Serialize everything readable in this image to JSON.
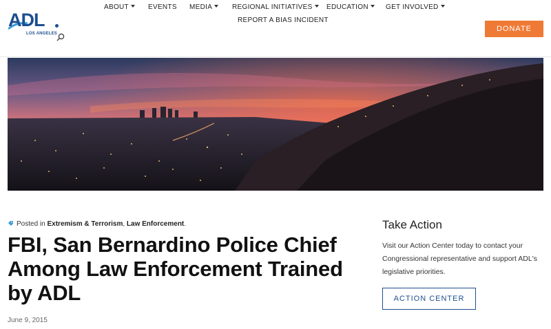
{
  "logo": {
    "text": "ADL",
    "subtext": "LOS ANGELES"
  },
  "nav": {
    "items": [
      {
        "label": "ABOUT",
        "dropdown": true
      },
      {
        "label": "EVENTS",
        "dropdown": false
      },
      {
        "label": "MEDIA",
        "dropdown": true
      },
      {
        "label": "REGIONAL INITIATIVES",
        "dropdown": true
      },
      {
        "label": "EDUCATION",
        "dropdown": true
      },
      {
        "label": "GET INVOLVED",
        "dropdown": true
      },
      {
        "label": "REPORT A BIAS INCIDENT",
        "dropdown": false
      }
    ]
  },
  "donate": {
    "label": "DONATE"
  },
  "icons": {
    "search": "search-icon",
    "tag": "tag-icon"
  },
  "colors": {
    "brand_blue": "#1d4e8f",
    "donate_orange": "#ef7a35"
  },
  "article": {
    "posted_prefix": "Posted in",
    "categories": [
      "Extremism & Terrorism",
      "Law Enforcement"
    ],
    "category_separator": ",",
    "posted_suffix": ".",
    "title": "FBI, San Bernardino Police Chief Among Law Enforcement Trained by ADL",
    "date": "June 9, 2015"
  },
  "sidebar": {
    "title": "Take Action",
    "text": "Visit our Action Center today to contact your Congressional representative and support ADL's legislative priorities.",
    "button_label": "ACTION CENTER"
  }
}
